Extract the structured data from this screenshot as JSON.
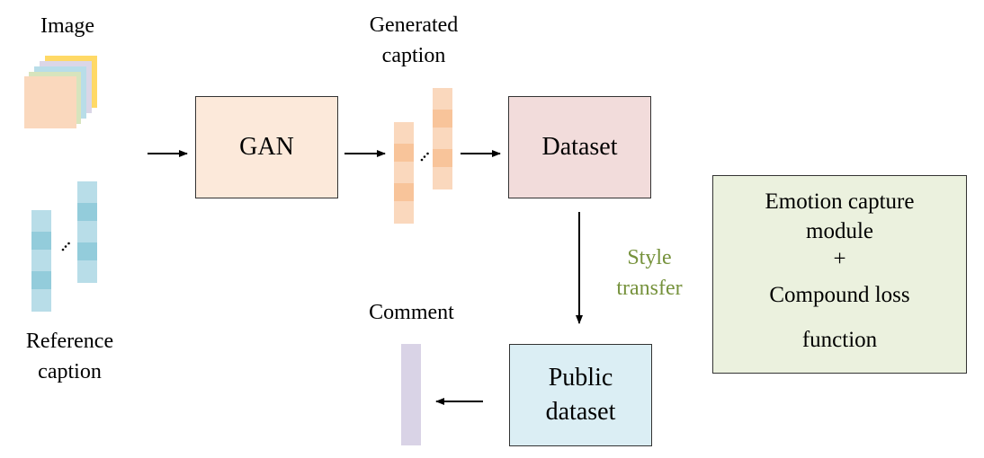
{
  "labels": {
    "image": "Image",
    "reference_caption": "Reference caption",
    "generated_caption": "Generated caption",
    "comment": "Comment",
    "style_transfer": "Style transfer"
  },
  "boxes": {
    "gan": "GAN",
    "dataset": "Dataset",
    "public_dataset": "Public dataset",
    "module_line1": "Emotion capture module",
    "module_plus": "+",
    "module_line2": "Compound loss function"
  },
  "colors": {
    "gan_fill": "#FCE9DA",
    "dataset_fill": "#F2DCDB",
    "public_fill": "#DBEEF4",
    "module_fill": "#EBF1DE",
    "style_text": "#76923C",
    "comment_bar": "#D9D3E6",
    "orange_light": "#FAD8BD",
    "orange_dark": "#F8C49A",
    "blue_light": "#B8DDE8",
    "blue_dark": "#93CCDB"
  }
}
